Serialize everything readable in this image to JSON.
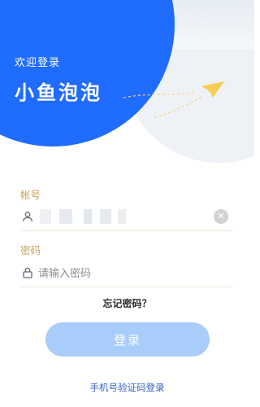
{
  "header": {
    "welcome_text": "欢迎登录",
    "app_name": "小鱼泡泡"
  },
  "form": {
    "account_label": "帐号",
    "account_value": "",
    "password_label": "密码",
    "password_placeholder": "请输入密码",
    "forgot_password": "忘记密码？",
    "clear_glyph": "✕"
  },
  "actions": {
    "login_button": "登录",
    "sms_login": "手机号验证码登录"
  },
  "colors": {
    "brand_blue": "#1f6cff",
    "label_gold": "#c8a35a",
    "button_disabled": "#a9cdfa",
    "link_blue": "#2f5fc4"
  },
  "icons": {
    "account": "user-icon",
    "password": "lock-icon",
    "clear": "clear-icon",
    "decor": "paper-plane-icon"
  }
}
